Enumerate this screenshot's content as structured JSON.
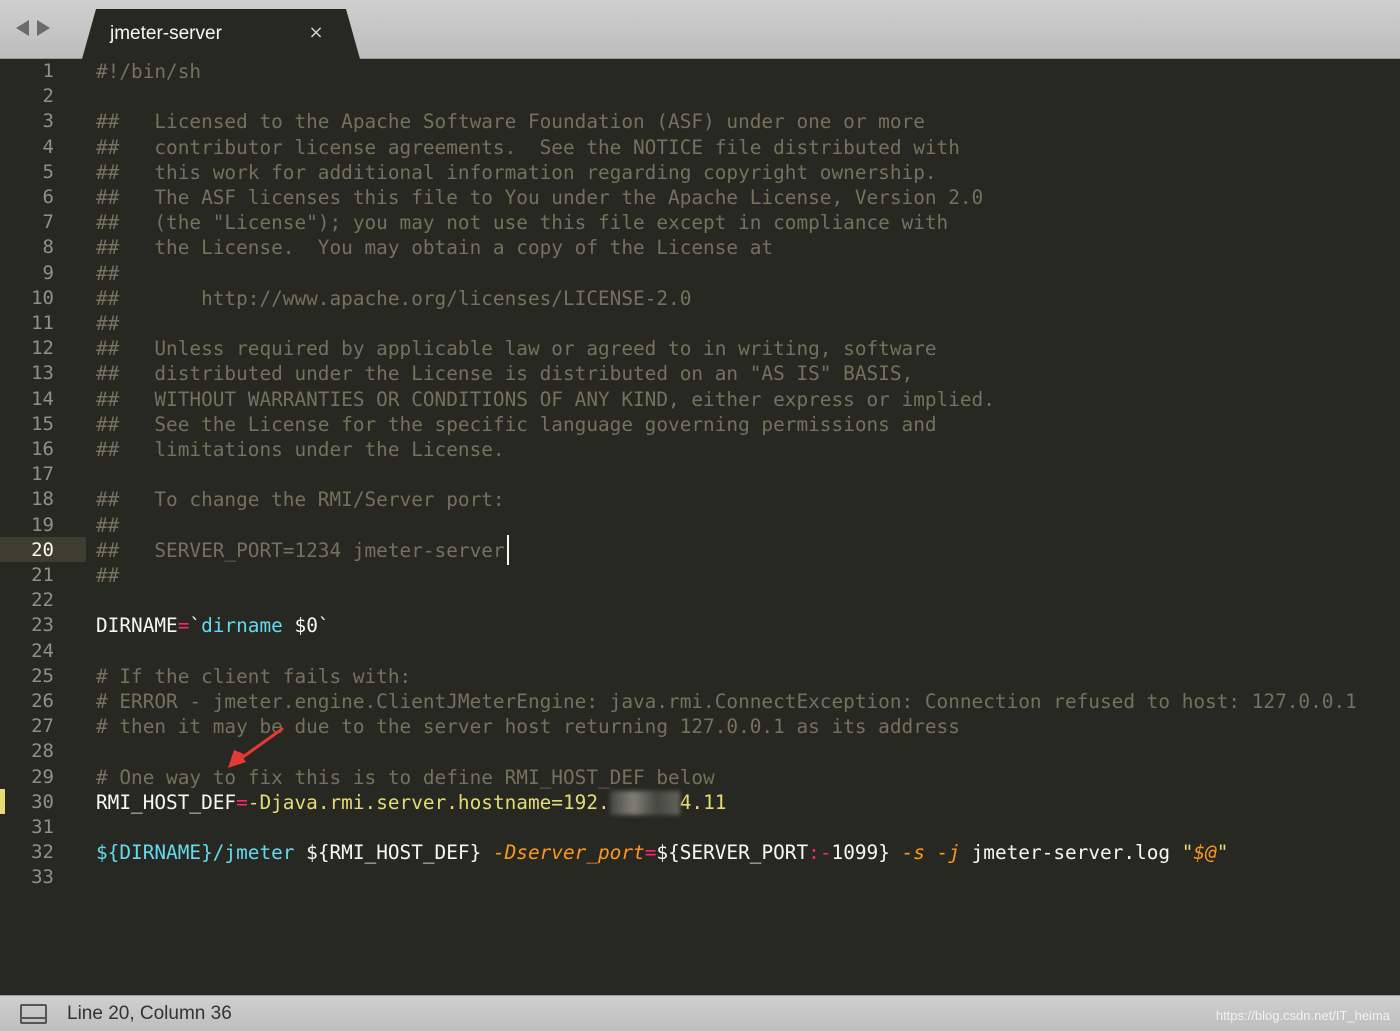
{
  "tab": {
    "title": "jmeter-server",
    "close_glyph": "×"
  },
  "editor": {
    "current_line": 20,
    "line_numbers": [
      "1",
      "2",
      "3",
      "4",
      "5",
      "6",
      "7",
      "8",
      "9",
      "10",
      "11",
      "12",
      "13",
      "14",
      "15",
      "16",
      "17",
      "18",
      "19",
      "20",
      "21",
      "22",
      "23",
      "24",
      "25",
      "26",
      "27",
      "28",
      "29",
      "30",
      "31",
      "32",
      "33"
    ],
    "lines": [
      [
        {
          "t": "#!/bin/sh",
          "c": "comment"
        }
      ],
      [],
      [
        {
          "t": "##   Licensed to the Apache Software Foundation (ASF) under one or more",
          "c": "comment"
        }
      ],
      [
        {
          "t": "##   contributor license agreements.  See the NOTICE file distributed with",
          "c": "comment"
        }
      ],
      [
        {
          "t": "##   this work for additional information regarding copyright ownership.",
          "c": "comment"
        }
      ],
      [
        {
          "t": "##   The ASF licenses this file to You under the Apache License, Version 2.0",
          "c": "comment"
        }
      ],
      [
        {
          "t": "##   (the \"License\"); you may not use this file except in compliance with",
          "c": "comment"
        }
      ],
      [
        {
          "t": "##   the License.  You may obtain a copy of the License at",
          "c": "comment"
        }
      ],
      [
        {
          "t": "##",
          "c": "comment"
        }
      ],
      [
        {
          "t": "##       http://www.apache.org/licenses/LICENSE-2.0",
          "c": "comment"
        }
      ],
      [
        {
          "t": "##",
          "c": "comment"
        }
      ],
      [
        {
          "t": "##   Unless required by applicable law or agreed to in writing, software",
          "c": "comment"
        }
      ],
      [
        {
          "t": "##   distributed under the License is distributed on an \"AS IS\" BASIS,",
          "c": "comment"
        }
      ],
      [
        {
          "t": "##   WITHOUT WARRANTIES OR CONDITIONS OF ANY KIND, either express or implied.",
          "c": "comment"
        }
      ],
      [
        {
          "t": "##   See the License for the specific language governing permissions and",
          "c": "comment"
        }
      ],
      [
        {
          "t": "##   limitations under the License.",
          "c": "comment"
        }
      ],
      [],
      [
        {
          "t": "##   To change the RMI/Server port:",
          "c": "comment"
        }
      ],
      [
        {
          "t": "##",
          "c": "comment"
        }
      ],
      [
        {
          "t": "##   SERVER_PORT=1234 jmeter-server",
          "c": "comment"
        }
      ],
      [
        {
          "t": "##",
          "c": "comment"
        }
      ],
      [],
      [
        {
          "t": "DIRNAME",
          "c": "white"
        },
        {
          "t": "=",
          "c": "op"
        },
        {
          "t": "`",
          "c": "white"
        },
        {
          "t": "dirname",
          "c": "builtin"
        },
        {
          "t": " $0`",
          "c": "white"
        }
      ],
      [],
      [
        {
          "t": "# If the client fails with:",
          "c": "comment"
        }
      ],
      [
        {
          "t": "# ERROR - jmeter.engine.ClientJMeterEngine: java.rmi.ConnectException: Connection refused to host: 127.0.0.1",
          "c": "comment"
        }
      ],
      [
        {
          "t": "# then it may be due to the server host returning 127.0.0.1 as its address",
          "c": "comment"
        }
      ],
      [],
      [
        {
          "t": "# One way to fix this is to define RMI_HOST_DEF below",
          "c": "comment"
        }
      ],
      [
        {
          "t": "RMI_HOST_DEF",
          "c": "white"
        },
        {
          "t": "=",
          "c": "op"
        },
        {
          "t": "-Djava.rmi.server.hostname=192.      4.11",
          "c": "str"
        }
      ],
      [],
      [
        {
          "t": "${DIRNAME}/jmeter",
          "c": "builtin"
        },
        {
          "t": " ${RMI_HOST_DEF} ",
          "c": "white"
        },
        {
          "t": "-Dserver_port",
          "c": "param"
        },
        {
          "t": "=",
          "c": "op"
        },
        {
          "t": "${SERVER_PORT",
          "c": "white"
        },
        {
          "t": ":-",
          "c": "op"
        },
        {
          "t": "1099} ",
          "c": "white"
        },
        {
          "t": "-s -j",
          "c": "param"
        },
        {
          "t": " jmeter-server.log ",
          "c": "white"
        },
        {
          "t": "\"",
          "c": "str"
        },
        {
          "t": "$@",
          "c": "param"
        },
        {
          "t": "\"",
          "c": "str"
        }
      ],
      []
    ]
  },
  "status": {
    "position": "Line 20, Column 36"
  },
  "watermark": "https://blog.csdn.net/IT_heima",
  "colors": {
    "background": "#272822",
    "comment": "#75715e",
    "keyword": "#f92672",
    "builtin": "#66d9ef",
    "param": "#fd971f",
    "string": "#e6db74",
    "annotation_arrow": "#e53935"
  },
  "icons": [
    "back-arrow-icon",
    "forward-arrow-icon",
    "close-icon",
    "panel-toggle-icon",
    "annotation-arrow-icon"
  ]
}
